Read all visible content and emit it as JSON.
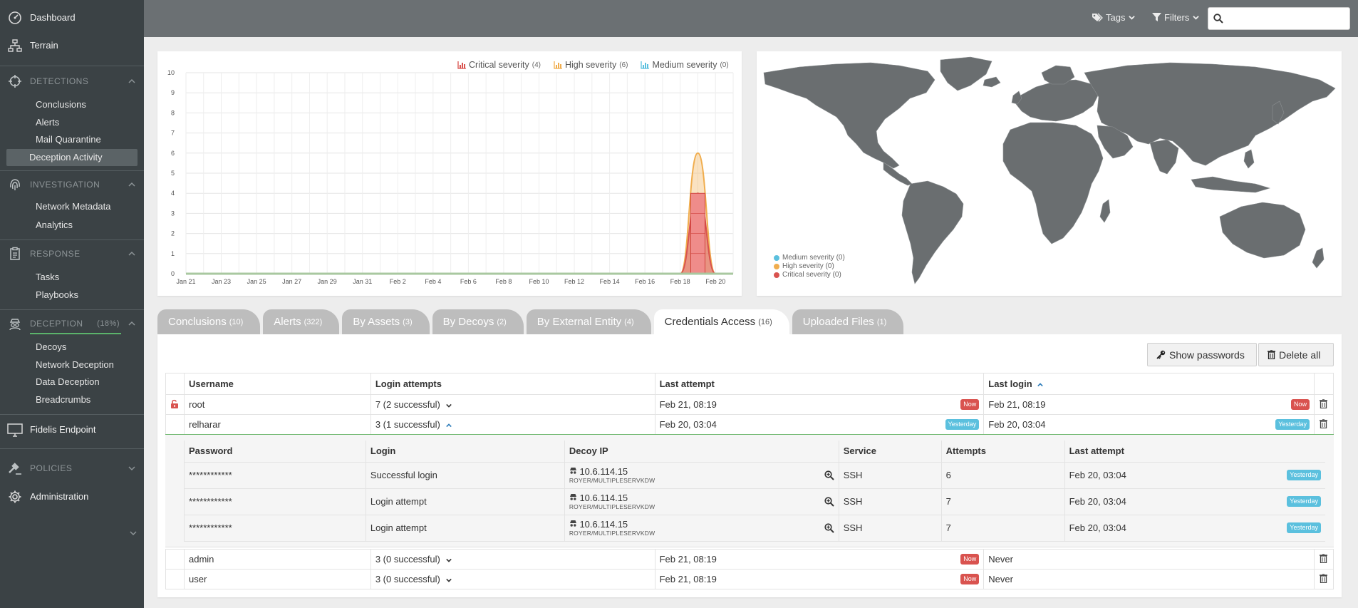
{
  "sidebar": {
    "dashboard": "Dashboard",
    "terrain": "Terrain",
    "detections": {
      "title": "DETECTIONS",
      "items": [
        "Conclusions",
        "Alerts",
        "Mail Quarantine",
        "Deception Activity"
      ]
    },
    "investigation": {
      "title": "INVESTIGATION",
      "items": [
        "Network Metadata",
        "Analytics"
      ]
    },
    "response": {
      "title": "RESPONSE",
      "items": [
        "Tasks",
        "Playbooks"
      ]
    },
    "deception": {
      "title": "DECEPTION",
      "percent": "(18%)",
      "progress": 0.18,
      "items": [
        "Decoys",
        "Network Deception",
        "Data Deception",
        "Breadcrumbs"
      ]
    },
    "fidelis_endpoint": "Fidelis Endpoint",
    "policies": "POLICIES",
    "administration": "Administration"
  },
  "topbar": {
    "tags": "Tags",
    "filters": "Filters",
    "search_placeholder": ""
  },
  "chart_data": {
    "type": "area",
    "x": [
      "Jan 21",
      "Jan 22",
      "Jan 23",
      "Jan 24",
      "Jan 25",
      "Jan 26",
      "Jan 27",
      "Jan 28",
      "Jan 29",
      "Jan 30",
      "Jan 31",
      "Feb 1",
      "Feb 2",
      "Feb 3",
      "Feb 4",
      "Feb 5",
      "Feb 6",
      "Feb 7",
      "Feb 8",
      "Feb 9",
      "Feb 10",
      "Feb 11",
      "Feb 12",
      "Feb 13",
      "Feb 14",
      "Feb 15",
      "Feb 16",
      "Feb 17",
      "Feb 18",
      "Feb 19",
      "Feb 20",
      "Feb 21"
    ],
    "tick_labels": [
      "Jan 21",
      "Jan 23",
      "Jan 25",
      "Jan 27",
      "Jan 29",
      "Jan 31",
      "Feb 2",
      "Feb 4",
      "Feb 6",
      "Feb 8",
      "Feb 10",
      "Feb 12",
      "Feb 14",
      "Feb 16",
      "Feb 18",
      "Feb 20"
    ],
    "y_ticks": [
      "0",
      "1",
      "2",
      "3",
      "4",
      "5",
      "6",
      "7",
      "8",
      "9",
      "10"
    ],
    "ylim": [
      0,
      10
    ],
    "grid": true,
    "legend_position": "top-right",
    "series": [
      {
        "name": "Critical severity",
        "count": "(4)",
        "color": "#d9534f",
        "values": [
          0,
          0,
          0,
          0,
          0,
          0,
          0,
          0,
          0,
          0,
          0,
          0,
          0,
          0,
          0,
          0,
          0,
          0,
          0,
          0,
          0,
          0,
          0,
          0,
          0,
          0,
          0,
          0,
          0,
          4,
          0,
          0
        ]
      },
      {
        "name": "High severity",
        "count": "(6)",
        "color": "#f0ad4e",
        "values": [
          0,
          0,
          0,
          0,
          0,
          0,
          0,
          0,
          0,
          0,
          0,
          0,
          0,
          0,
          0,
          0,
          0,
          0,
          0,
          0,
          0,
          0,
          0,
          0,
          0,
          0,
          0,
          0,
          0,
          6,
          0,
          0
        ]
      },
      {
        "name": "Medium severity",
        "count": "(0)",
        "color": "#5bc0de",
        "values": [
          0,
          0,
          0,
          0,
          0,
          0,
          0,
          0,
          0,
          0,
          0,
          0,
          0,
          0,
          0,
          0,
          0,
          0,
          0,
          0,
          0,
          0,
          0,
          0,
          0,
          0,
          0,
          0,
          0,
          0,
          0,
          0
        ]
      }
    ]
  },
  "map_legend": [
    {
      "label": "Medium severity (0)",
      "color": "#5bc0de"
    },
    {
      "label": "High severity (0)",
      "color": "#f0ad4e"
    },
    {
      "label": "Critical severity (0)",
      "color": "#d9534f"
    }
  ],
  "tabs": [
    {
      "label": "Conclusions",
      "count": "(10)"
    },
    {
      "label": "Alerts",
      "count": "(322)"
    },
    {
      "label": "By Assets",
      "count": "(3)"
    },
    {
      "label": "By Decoys",
      "count": "(2)"
    },
    {
      "label": "By External Entity",
      "count": "(4)"
    },
    {
      "label": "Credentials Access",
      "count": "(16)"
    },
    {
      "label": "Uploaded Files",
      "count": "(1)"
    }
  ],
  "actions": {
    "show_passwords": "Show passwords",
    "delete_all": "Delete all"
  },
  "creds_table": {
    "headers": [
      "Username",
      "Login attempts",
      "Last attempt",
      "Last login"
    ],
    "rows": [
      {
        "username": "root",
        "attempts": "7 (2 successful)",
        "last_attempt": "Feb 21, 08:19",
        "last_attempt_badge": "Now",
        "last_login": "Feb 21, 08:19",
        "last_login_badge": "Now"
      },
      {
        "username": "relharar",
        "attempts": "3 (1 successful)",
        "last_attempt": "Feb 20, 03:04",
        "last_attempt_badge": "Yesterday",
        "last_login": "Feb 20, 03:04",
        "last_login_badge": "Yesterday"
      },
      {
        "username": "admin",
        "attempts": "3 (0 successful)",
        "last_attempt": "Feb 21, 08:19",
        "last_attempt_badge": "Now",
        "last_login": "Never"
      },
      {
        "username": "user",
        "attempts": "3 (0 successful)",
        "last_attempt": "Feb 21, 08:19",
        "last_attempt_badge": "Now",
        "last_login": "Never"
      }
    ]
  },
  "detail_table": {
    "headers": [
      "Password",
      "Login",
      "Decoy IP",
      "Service",
      "Attempts",
      "Last attempt"
    ],
    "rows": [
      {
        "password": "************",
        "login": "Successful login",
        "ip": "10.6.114.15",
        "host": "ROYER/MULTIPLESERVKDW",
        "service": "SSH",
        "attempts": "6",
        "last": "Feb 20, 03:04",
        "badge": "Yesterday"
      },
      {
        "password": "************",
        "login": "Login attempt",
        "ip": "10.6.114.15",
        "host": "ROYER/MULTIPLESERVKDW",
        "service": "SSH",
        "attempts": "7",
        "last": "Feb 20, 03:04",
        "badge": "Yesterday"
      },
      {
        "password": "************",
        "login": "Login attempt",
        "ip": "10.6.114.15",
        "host": "ROYER/MULTIPLESERVKDW",
        "service": "SSH",
        "attempts": "7",
        "last": "Feb 20, 03:04",
        "badge": "Yesterday"
      }
    ]
  }
}
